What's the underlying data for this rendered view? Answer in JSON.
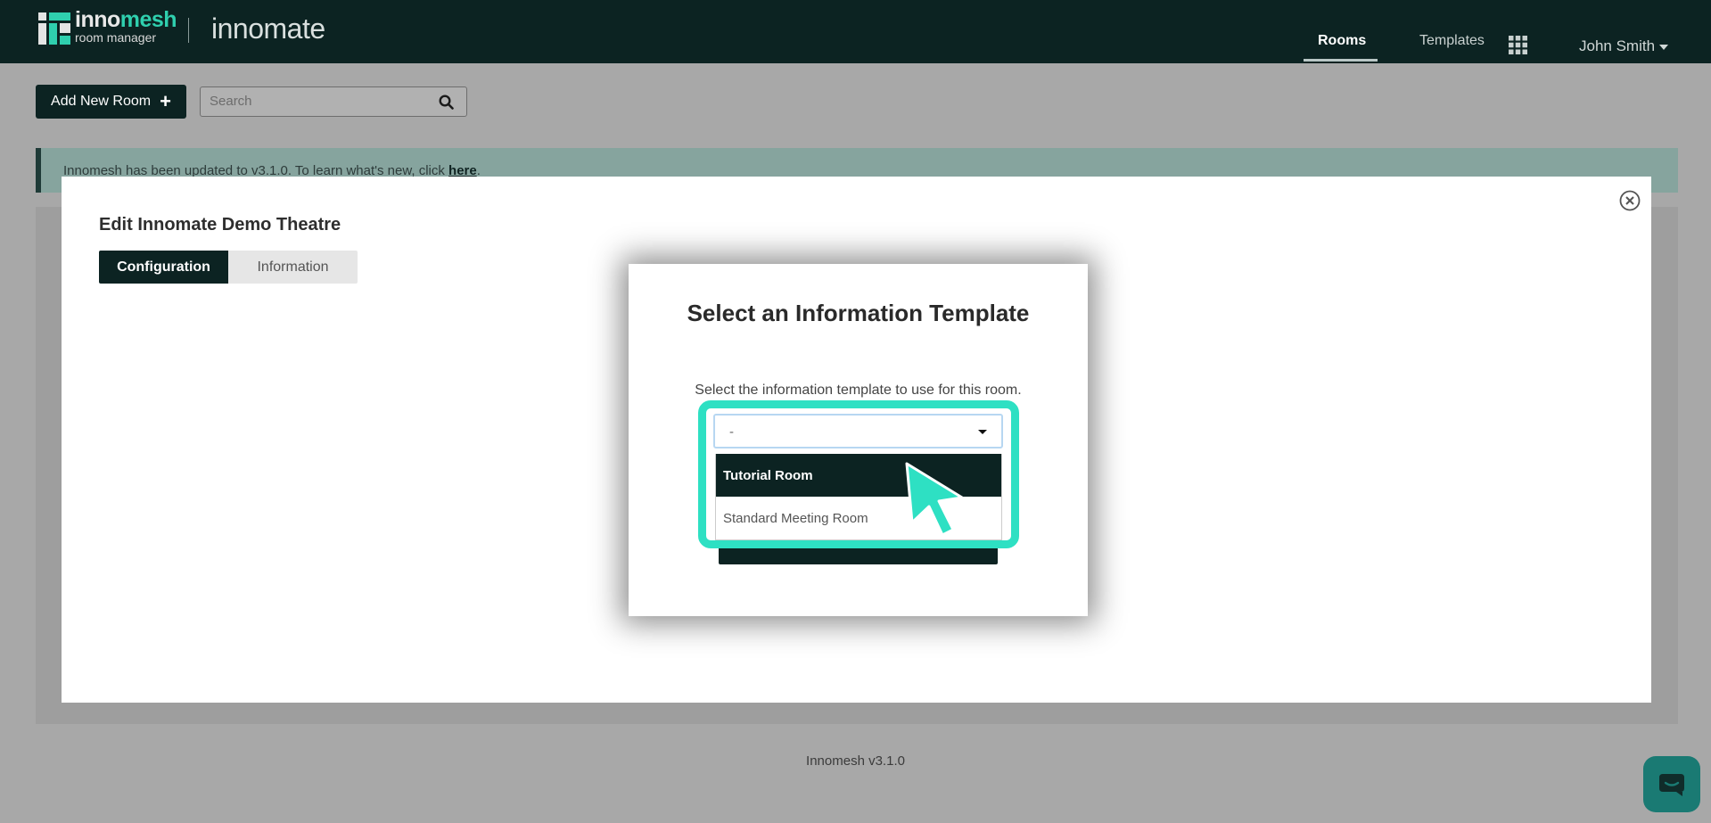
{
  "topbar": {
    "logo": {
      "brand_part1": "inno",
      "brand_part2": "mesh",
      "subtitle": "room manager"
    },
    "product_name": "innomate",
    "nav": {
      "rooms": "Rooms",
      "templates": "Templates"
    },
    "apps_icon": "grid-icon",
    "user_name": "John Smith"
  },
  "toolbar": {
    "add_room_label": "Add New Room",
    "search_placeholder": "Search"
  },
  "banner": {
    "text": "Innomesh has been updated to v3.1.0. To learn what's new, click ",
    "link_text": "here",
    "after_link": "."
  },
  "edit_modal": {
    "title": "Edit Innomate Demo Theatre",
    "tabs": [
      {
        "label": "Configuration",
        "active": true
      },
      {
        "label": "Information",
        "active": false
      }
    ]
  },
  "template_dialog": {
    "title": "Select an Information Template",
    "description": "Select the information template to use for this room.",
    "select": {
      "value": "-",
      "options": [
        {
          "label": "Tutorial Room",
          "highlighted": true
        },
        {
          "label": "Standard Meeting Room",
          "highlighted": false
        }
      ]
    }
  },
  "footer": {
    "version": "Innomesh v3.1.0"
  },
  "colors": {
    "nav_bg": "#0c2322",
    "accent": "#2fcfae",
    "highlight": "#2ee0c3",
    "overlay_bg": "#a8a8a8"
  }
}
